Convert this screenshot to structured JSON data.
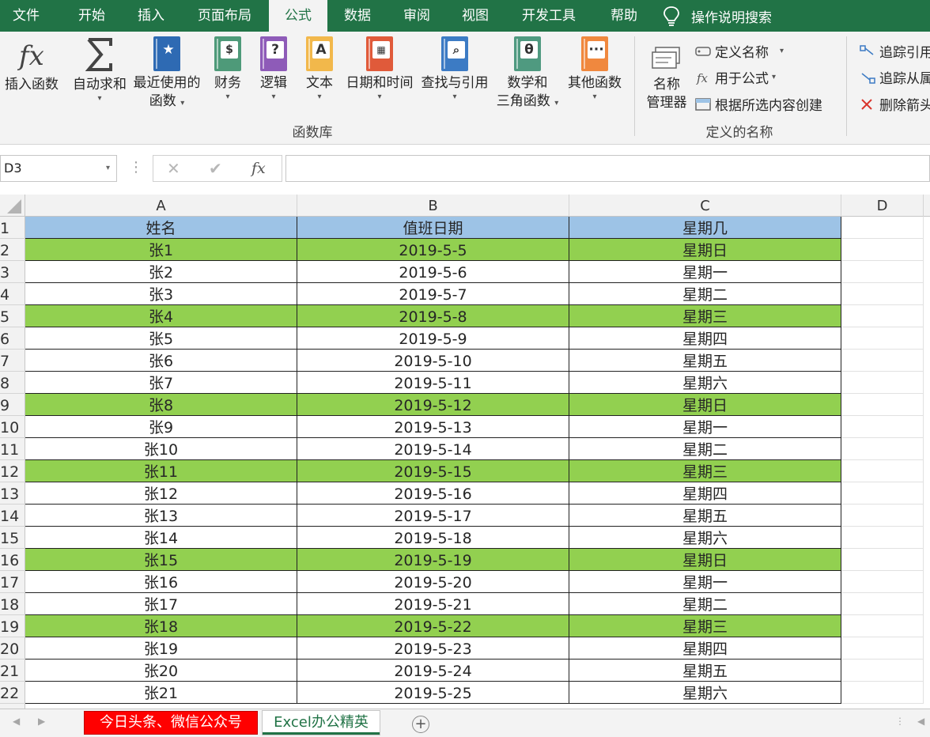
{
  "ribbon_tabs": [
    "文件",
    "开始",
    "插入",
    "页面布局",
    "公式",
    "数据",
    "审阅",
    "视图",
    "开发工具",
    "帮助"
  ],
  "active_tab": "公式",
  "tell_me": "操作说明搜索",
  "ribbon": {
    "insert_function": "插入函数",
    "autosum": "自动求和",
    "recent_line1": "最近使用的",
    "recent_line2": "函数",
    "financial": "财务",
    "logical": "逻辑",
    "text": "文本",
    "datetime": "日期和时间",
    "lookup": "查找与引用",
    "math_line1": "数学和",
    "math_line2": "三角函数",
    "more": "其他函数",
    "function_library": "函数库",
    "name_manager_line1": "名称",
    "name_manager_line2": "管理器",
    "define_name": "定义名称",
    "use_in_formula": "用于公式",
    "create_from_selection": "根据所选内容创建",
    "defined_names": "定义的名称",
    "trace_precedents": "追踪引用",
    "trace_dependents": "追踪从属",
    "remove_arrows": "删除箭头",
    "colors": {
      "excel_green": "#217346",
      "financial": "#4e9a79",
      "logical": "#8e5bb8",
      "text": "#f2b84b",
      "datetime": "#e05a3a",
      "lookup": "#3c7bc4",
      "math": "#4f9a80",
      "more": "#f0883e",
      "recent": "#2e6ab3"
    }
  },
  "formula_bar": {
    "name_box": "D3",
    "cancel": "✕",
    "enter": "✔",
    "fx": "fx",
    "value": ""
  },
  "columns": [
    "A",
    "B",
    "C",
    "D"
  ],
  "header_row": {
    "name": "姓名",
    "date": "值班日期",
    "weekday": "星期几"
  },
  "rows": [
    {
      "name": "张1",
      "date": "2019-5-5",
      "weekday": "星期日",
      "highlight": true
    },
    {
      "name": "张2",
      "date": "2019-5-6",
      "weekday": "星期一",
      "highlight": false
    },
    {
      "name": "张3",
      "date": "2019-5-7",
      "weekday": "星期二",
      "highlight": false
    },
    {
      "name": "张4",
      "date": "2019-5-8",
      "weekday": "星期三",
      "highlight": true
    },
    {
      "name": "张5",
      "date": "2019-5-9",
      "weekday": "星期四",
      "highlight": false
    },
    {
      "name": "张6",
      "date": "2019-5-10",
      "weekday": "星期五",
      "highlight": false
    },
    {
      "name": "张7",
      "date": "2019-5-11",
      "weekday": "星期六",
      "highlight": false
    },
    {
      "name": "张8",
      "date": "2019-5-12",
      "weekday": "星期日",
      "highlight": true
    },
    {
      "name": "张9",
      "date": "2019-5-13",
      "weekday": "星期一",
      "highlight": false
    },
    {
      "name": "张10",
      "date": "2019-5-14",
      "weekday": "星期二",
      "highlight": false
    },
    {
      "name": "张11",
      "date": "2019-5-15",
      "weekday": "星期三",
      "highlight": true
    },
    {
      "name": "张12",
      "date": "2019-5-16",
      "weekday": "星期四",
      "highlight": false
    },
    {
      "name": "张13",
      "date": "2019-5-17",
      "weekday": "星期五",
      "highlight": false
    },
    {
      "name": "张14",
      "date": "2019-5-18",
      "weekday": "星期六",
      "highlight": false
    },
    {
      "name": "张15",
      "date": "2019-5-19",
      "weekday": "星期日",
      "highlight": true
    },
    {
      "name": "张16",
      "date": "2019-5-20",
      "weekday": "星期一",
      "highlight": false
    },
    {
      "name": "张17",
      "date": "2019-5-21",
      "weekday": "星期二",
      "highlight": false
    },
    {
      "name": "张18",
      "date": "2019-5-22",
      "weekday": "星期三",
      "highlight": true
    },
    {
      "name": "张19",
      "date": "2019-5-23",
      "weekday": "星期四",
      "highlight": false
    },
    {
      "name": "张20",
      "date": "2019-5-24",
      "weekday": "星期五",
      "highlight": false
    },
    {
      "name": "张21",
      "date": "2019-5-25",
      "weekday": "星期六",
      "highlight": false
    }
  ],
  "colors": {
    "header_fill": "#9dc3e6",
    "highlight_fill": "#92d050"
  },
  "sheet_tabs": [
    {
      "label": "今日头条、微信公众号",
      "fill": "#ff0000",
      "text": "#ffffff",
      "active": false
    },
    {
      "label": "Excel办公精英",
      "fill": "#ffffff",
      "text": "#217346",
      "active": true
    }
  ],
  "add_sheet": "+"
}
